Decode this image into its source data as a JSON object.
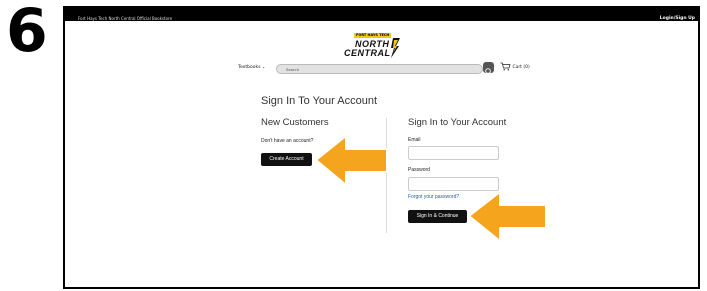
{
  "step_number": "6",
  "site": {
    "topbar_title": "Fort Hays Tech North Central Official Bookstore",
    "login_label": "Login/Sign Up",
    "logo_tag": "FORT HAYS TECH",
    "logo_line1": "NORTH",
    "logo_line2": "CENTRAL"
  },
  "nav": {
    "textbooks_label": "Textbooks",
    "search_placeholder": "Search",
    "cart_label": "Cart (0)"
  },
  "page": {
    "title": "Sign In To Your Account",
    "new_customers": {
      "heading": "New Customers",
      "prompt": "Don't have an account?",
      "create_button": "Create Account"
    },
    "sign_in": {
      "heading": "Sign In to Your Account",
      "email_label": "Email",
      "email_value": "",
      "password_label": "Password",
      "password_value": "",
      "forgot_link": "Forgot your password?",
      "submit_button": "Sign In & Continue"
    }
  },
  "colors": {
    "arrow": "#F5A41D",
    "link": "#1a62b3",
    "logo_accent": "#f5c518"
  }
}
